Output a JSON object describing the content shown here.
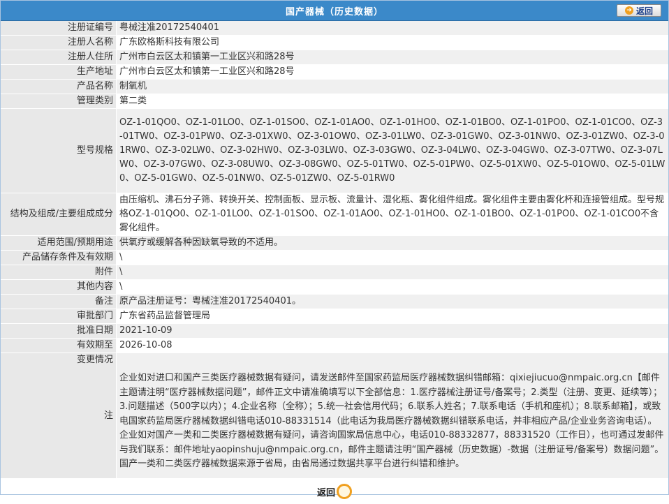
{
  "header": {
    "title": "国产器械（历史数据）",
    "back_label": "返回"
  },
  "rows": [
    {
      "label": "注册证编号",
      "value": "粤械注准20172540401"
    },
    {
      "label": "注册人名称",
      "value": "广东欧格斯科技有限公司"
    },
    {
      "label": "注册人住所",
      "value": "广州市白云区太和镇第一工业区兴和路28号"
    },
    {
      "label": "生产地址",
      "value": "广州市白云区太和镇第一工业区兴和路28号"
    },
    {
      "label": "产品名称",
      "value": "制氧机"
    },
    {
      "label": "管理类别",
      "value": "第二类"
    },
    {
      "label": "型号规格",
      "value": "OZ-1-01QO0、OZ-1-01LO0、OZ-1-01SO0、OZ-1-01AO0、OZ-1-01HO0、OZ-1-01BO0、OZ-1-01PO0、OZ-1-01CO0、OZ-3-01TW0、OZ-3-01PW0、OZ-3-01XW0、OZ-3-01OW0、OZ-3-01LW0、OZ-3-01GW0、OZ-3-01NW0、OZ-3-01ZW0、OZ-3-01RW0、OZ-3-02LW0、OZ-3-02HW0、OZ-3-03LW0、OZ-3-03GW0、OZ-3-04LW0、OZ-3-04GW0、OZ-3-07TW0、OZ-3-07LW0、OZ-3-07GW0、OZ-3-08UW0、OZ-3-08GW0、OZ-5-01TW0、OZ-5-01PW0、OZ-5-01XW0、OZ-5-01OW0、OZ-5-01LW0、OZ-5-01GW0、OZ-5-01NW0、OZ-5-01ZW0、OZ-5-01RW0"
    },
    {
      "label": "结构及组成/主要组成成分",
      "value": "由压缩机、沸石分子筛、转换开关、控制面板、显示板、流量计、湿化瓶、雾化组件组成。雾化组件主要由雾化杯和连接管组成。型号规格OZ-1-01QO0、OZ-1-01LO0、OZ-1-01SO0、OZ-1-01AO0、OZ-1-01HO0、OZ-1-01BO0、OZ-1-01PO0、OZ-1-01CO0不含雾化组件。"
    },
    {
      "label": "适用范围/预期用途",
      "value": "供氧疗或缓解各种因缺氧导致的不适用。"
    },
    {
      "label": "产品储存条件及有效期",
      "value": "\\"
    },
    {
      "label": "附件",
      "value": "\\"
    },
    {
      "label": "其他内容",
      "value": "\\"
    },
    {
      "label": "备注",
      "value": "原产品注册证号：粤械注准20172540401。"
    },
    {
      "label": "审批部门",
      "value": "广东省药品监督管理局"
    },
    {
      "label": "批准日期",
      "value": "2021-10-09"
    },
    {
      "label": "有效期至",
      "value": "2026-10-08"
    },
    {
      "label": "变更情况",
      "value": ""
    }
  ],
  "note": {
    "label": "注",
    "text": "企业如对进口和国产三类医疗器械数据有疑问，请发送邮件至国家药监局医疗器械数据纠错邮箱：qixiejiucuo@nmpaic.org.cn【邮件主题请注明“医疗器械数据问题”，邮件正文中请准确填写以下全部信息：1.医疗器械注册证号/备案号；2.类型（注册、变更、延续等）；3.问题描述（500字以内）；4.企业名称（全称）；5.统一社会信用代码；6.联系人姓名；7.联系电话（手机和座机）；8.联系邮箱】，或致电国家药监局医疗器械数据纠错电话010-88331514（此电话为我局医疗器械数据纠错联系电话，并非相应产品/企业业务咨询电话）。企业如对国产一类和二类医疗器械数据有疑问，请咨询国家局信息中心，电话010-88332877，88331520（工作日），也可通过发邮件与我们联系：邮件地址yaopinshuju@nmpaic.org.cn，邮件主题请注明“国产器械（历史数据）-数据（注册证号/备案号）数据问题”。国产一类和二类医疗器械数据来源于省局，由省局通过数据共享平台进行纠错和维护。"
  },
  "footer": {
    "back_label": "返回"
  }
}
